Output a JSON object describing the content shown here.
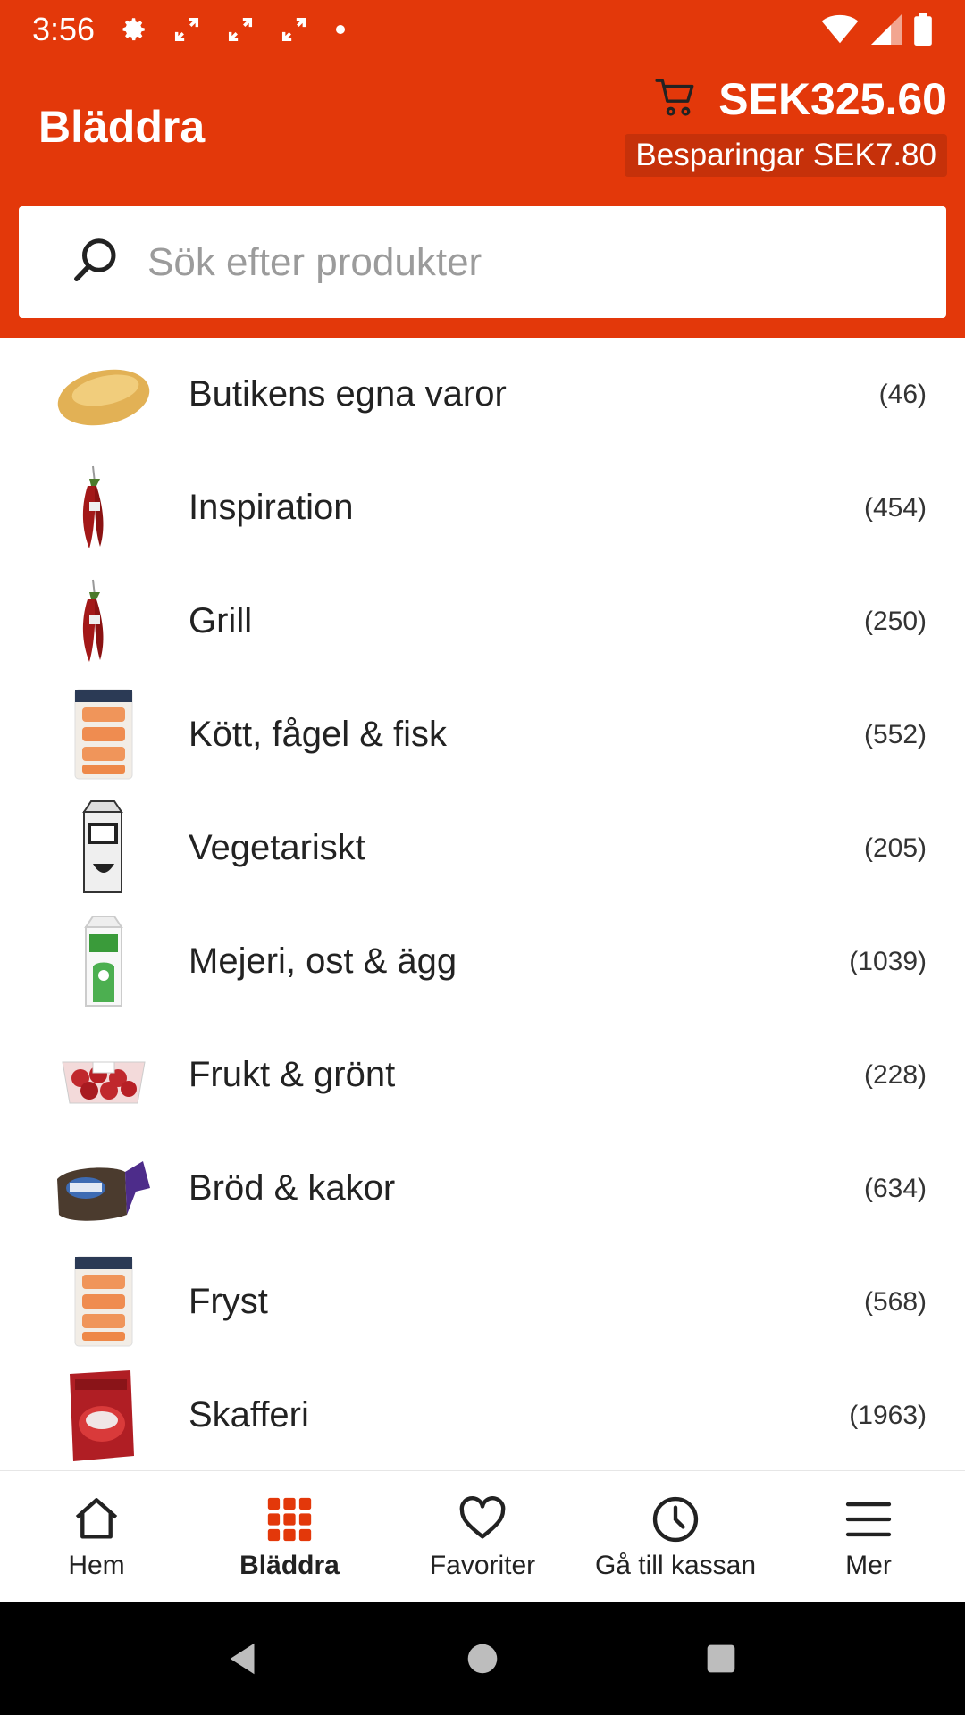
{
  "status_bar": {
    "time": "3:56"
  },
  "header": {
    "title": "Bläddra",
    "cart_total": "SEK325.60",
    "savings": "Besparingar SEK7.80"
  },
  "search": {
    "placeholder": "Sök efter produkter"
  },
  "categories": [
    {
      "label": "Butikens egna varor",
      "count": "(46)",
      "icon": "bread-roll"
    },
    {
      "label": "Inspiration",
      "count": "(454)",
      "icon": "chili-pepper"
    },
    {
      "label": "Grill",
      "count": "(250)",
      "icon": "chili-pepper"
    },
    {
      "label": "Kött, fågel & fisk",
      "count": "(552)",
      "icon": "salmon-pack"
    },
    {
      "label": "Vegetariskt",
      "count": "(205)",
      "icon": "oat-milk-carton"
    },
    {
      "label": "Mejeri, ost & ägg",
      "count": "(1039)",
      "icon": "milk-carton"
    },
    {
      "label": "Frukt & grönt",
      "count": "(228)",
      "icon": "tomato-box"
    },
    {
      "label": "Bröd & kakor",
      "count": "(634)",
      "icon": "bread-bag"
    },
    {
      "label": "Fryst",
      "count": "(568)",
      "icon": "salmon-pack"
    },
    {
      "label": "Skafferi",
      "count": "(1963)",
      "icon": "tomato-can"
    }
  ],
  "bottom_nav": [
    {
      "label": "Hem",
      "icon": "home-icon"
    },
    {
      "label": "Bläddra",
      "icon": "grid-icon",
      "active": true
    },
    {
      "label": "Favoriter",
      "icon": "heart-icon"
    },
    {
      "label": "Gå till kassan",
      "icon": "clock-icon"
    },
    {
      "label": "Mer",
      "icon": "menu-icon"
    }
  ],
  "colors": {
    "brand": "#e3380a",
    "active": "#e3380a"
  }
}
